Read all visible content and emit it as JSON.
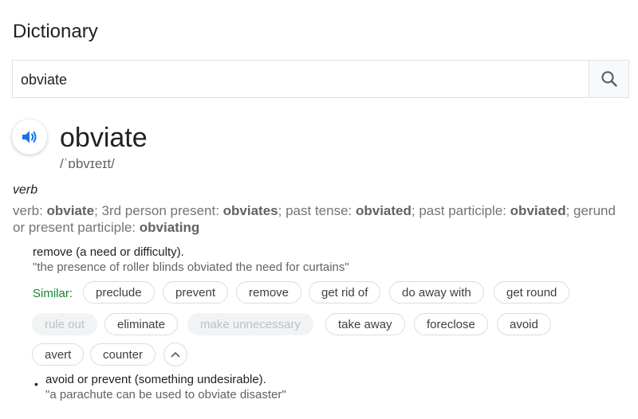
{
  "page": {
    "title": "Dictionary"
  },
  "search": {
    "value": "obviate"
  },
  "entry": {
    "word": "obviate",
    "phonetic": "/ˈɒbvɪeɪt/",
    "part_of_speech": "verb",
    "forms": [
      {
        "label": "verb: ",
        "value": "obviate"
      },
      {
        "label": "; 3rd person present: ",
        "value": "obviates"
      },
      {
        "label": "; past tense: ",
        "value": "obviated"
      },
      {
        "label": "; past participle: ",
        "value": "obviated"
      },
      {
        "label": "; gerund or present participle: ",
        "value": "obviating"
      }
    ],
    "senses": [
      {
        "definition": "remove (a need or difficulty).",
        "example": "\"the presence of roller blinds obviated the need for curtains\""
      },
      {
        "definition": "avoid or prevent (something undesirable).",
        "example": "\"a parachute can be used to obviate disaster\""
      }
    ],
    "similar_label": "Similar:",
    "similar": [
      {
        "word": "preclude",
        "dim": false
      },
      {
        "word": "prevent",
        "dim": false
      },
      {
        "word": "remove",
        "dim": false
      },
      {
        "word": "get rid of",
        "dim": false
      },
      {
        "word": "do away with",
        "dim": false
      },
      {
        "word": "get round",
        "dim": false
      },
      {
        "word": "rule out",
        "dim": true
      },
      {
        "word": "eliminate",
        "dim": false
      },
      {
        "word": "make unnecessary",
        "dim": true
      },
      {
        "word": "take away",
        "dim": false
      },
      {
        "word": "foreclose",
        "dim": false
      },
      {
        "word": "avoid",
        "dim": false
      },
      {
        "word": "avert",
        "dim": false
      },
      {
        "word": "counter",
        "dim": false
      }
    ]
  },
  "colors": {
    "accent_blue": "#1a73e8",
    "similar_green": "#188038",
    "dim_chip_bg": "#f1f3f4"
  },
  "icons": {
    "search": "search-icon",
    "speaker": "speaker-icon",
    "collapse": "chevron-up-icon"
  }
}
